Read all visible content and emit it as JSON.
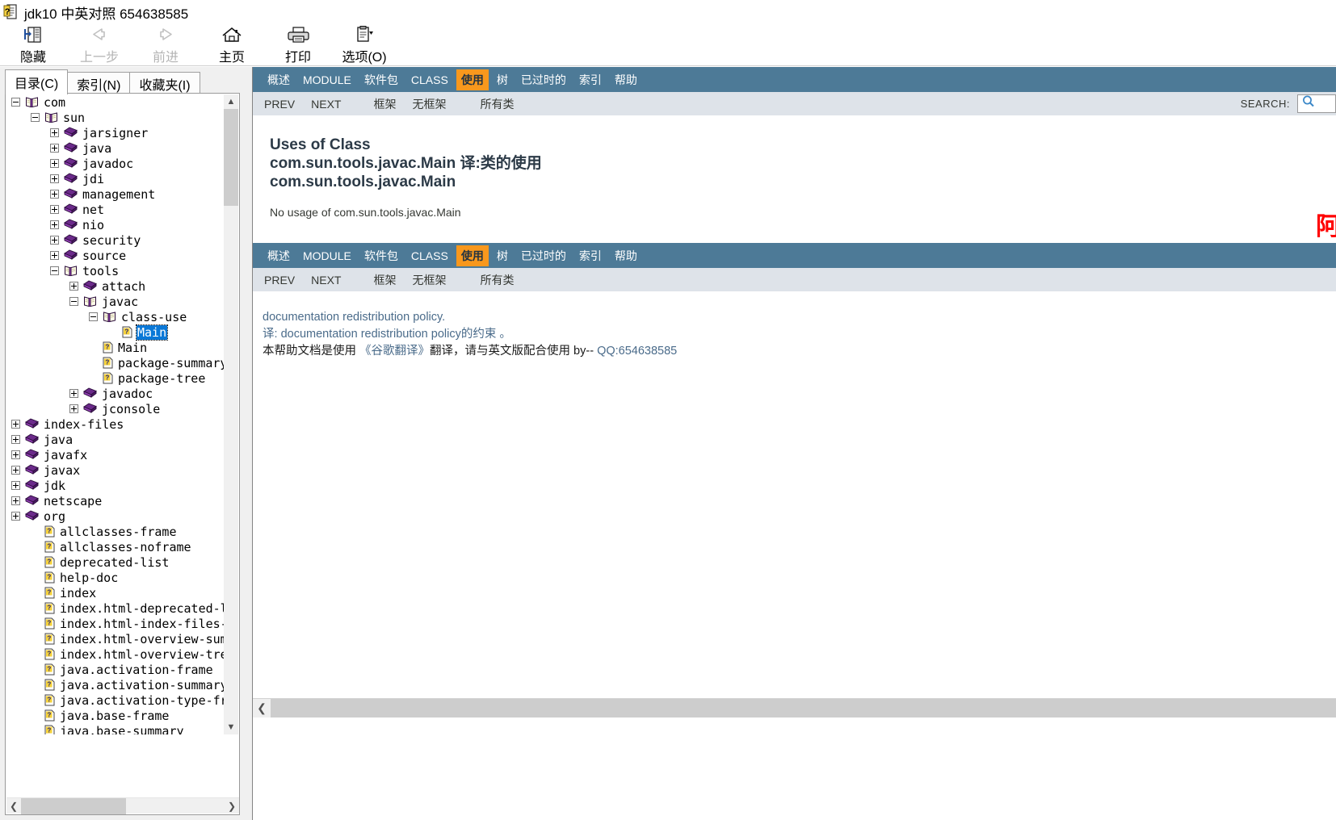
{
  "window": {
    "title": "jdk10 中英对照 654638585",
    "icon": "help-book-icon"
  },
  "toolbar": {
    "buttons": [
      {
        "label": "隐藏",
        "icon": "hide-pane-icon",
        "disabled": false
      },
      {
        "label": "上一步",
        "icon": "back-arrow-icon",
        "disabled": true
      },
      {
        "label": "前进",
        "icon": "forward-arrow-icon",
        "disabled": true
      },
      {
        "label": "主页",
        "icon": "home-icon",
        "disabled": false
      },
      {
        "label": "打印",
        "icon": "printer-icon",
        "disabled": false
      },
      {
        "label": "选项(O)",
        "icon": "options-icon",
        "disabled": false
      }
    ]
  },
  "sidebar": {
    "tabs": [
      {
        "label": "目录(C)",
        "active": true
      },
      {
        "label": "索引(N)",
        "active": false
      },
      {
        "label": "收藏夹(I)",
        "active": false
      }
    ],
    "tree": [
      {
        "label": "com",
        "indent": 0,
        "toggle": "minus",
        "icon": "open-book-icon",
        "selected": false
      },
      {
        "label": "sun",
        "indent": 1,
        "toggle": "minus",
        "icon": "open-book-icon",
        "selected": false
      },
      {
        "label": "jarsigner",
        "indent": 2,
        "toggle": "plus",
        "icon": "closed-book-icon",
        "selected": false
      },
      {
        "label": "java",
        "indent": 2,
        "toggle": "plus",
        "icon": "closed-book-icon",
        "selected": false
      },
      {
        "label": "javadoc",
        "indent": 2,
        "toggle": "plus",
        "icon": "closed-book-icon",
        "selected": false
      },
      {
        "label": "jdi",
        "indent": 2,
        "toggle": "plus",
        "icon": "closed-book-icon",
        "selected": false
      },
      {
        "label": "management",
        "indent": 2,
        "toggle": "plus",
        "icon": "closed-book-icon",
        "selected": false
      },
      {
        "label": "net",
        "indent": 2,
        "toggle": "plus",
        "icon": "closed-book-icon",
        "selected": false
      },
      {
        "label": "nio",
        "indent": 2,
        "toggle": "plus",
        "icon": "closed-book-icon",
        "selected": false
      },
      {
        "label": "security",
        "indent": 2,
        "toggle": "plus",
        "icon": "closed-book-icon",
        "selected": false
      },
      {
        "label": "source",
        "indent": 2,
        "toggle": "plus",
        "icon": "closed-book-icon",
        "selected": false
      },
      {
        "label": "tools",
        "indent": 2,
        "toggle": "minus",
        "icon": "open-book-icon",
        "selected": false
      },
      {
        "label": "attach",
        "indent": 3,
        "toggle": "plus",
        "icon": "closed-book-icon",
        "selected": false
      },
      {
        "label": "javac",
        "indent": 3,
        "toggle": "minus",
        "icon": "open-book-icon",
        "selected": false
      },
      {
        "label": "class-use",
        "indent": 4,
        "toggle": "minus",
        "icon": "open-book-icon",
        "selected": false
      },
      {
        "label": "Main",
        "indent": 5,
        "toggle": "none",
        "icon": "page-icon",
        "selected": true
      },
      {
        "label": "Main",
        "indent": 4,
        "toggle": "none",
        "icon": "page-icon",
        "selected": false
      },
      {
        "label": "package-summary",
        "indent": 4,
        "toggle": "none",
        "icon": "page-icon",
        "selected": false
      },
      {
        "label": "package-tree",
        "indent": 4,
        "toggle": "none",
        "icon": "page-icon",
        "selected": false
      },
      {
        "label": "javadoc",
        "indent": 3,
        "toggle": "plus",
        "icon": "closed-book-icon",
        "selected": false
      },
      {
        "label": "jconsole",
        "indent": 3,
        "toggle": "plus",
        "icon": "closed-book-icon",
        "selected": false
      },
      {
        "label": "index-files",
        "indent": 0,
        "toggle": "plus",
        "icon": "closed-book-icon",
        "selected": false
      },
      {
        "label": "java",
        "indent": 0,
        "toggle": "plus",
        "icon": "closed-book-icon",
        "selected": false
      },
      {
        "label": "javafx",
        "indent": 0,
        "toggle": "plus",
        "icon": "closed-book-icon",
        "selected": false
      },
      {
        "label": "javax",
        "indent": 0,
        "toggle": "plus",
        "icon": "closed-book-icon",
        "selected": false
      },
      {
        "label": "jdk",
        "indent": 0,
        "toggle": "plus",
        "icon": "closed-book-icon",
        "selected": false
      },
      {
        "label": "netscape",
        "indent": 0,
        "toggle": "plus",
        "icon": "closed-book-icon",
        "selected": false
      },
      {
        "label": "org",
        "indent": 0,
        "toggle": "plus",
        "icon": "closed-book-icon",
        "selected": false
      },
      {
        "label": "allclasses-frame",
        "indent": 1,
        "toggle": "none",
        "icon": "page-icon",
        "selected": false
      },
      {
        "label": "allclasses-noframe",
        "indent": 1,
        "toggle": "none",
        "icon": "page-icon",
        "selected": false
      },
      {
        "label": "deprecated-list",
        "indent": 1,
        "toggle": "none",
        "icon": "page-icon",
        "selected": false
      },
      {
        "label": "help-doc",
        "indent": 1,
        "toggle": "none",
        "icon": "page-icon",
        "selected": false
      },
      {
        "label": "index",
        "indent": 1,
        "toggle": "none",
        "icon": "page-icon",
        "selected": false
      },
      {
        "label": "index.html-deprecated-list",
        "indent": 1,
        "toggle": "none",
        "icon": "page-icon",
        "selected": false
      },
      {
        "label": "index.html-index-files-index",
        "indent": 1,
        "toggle": "none",
        "icon": "page-icon",
        "selected": false
      },
      {
        "label": "index.html-overview-summary",
        "indent": 1,
        "toggle": "none",
        "icon": "page-icon",
        "selected": false
      },
      {
        "label": "index.html-overview-tree",
        "indent": 1,
        "toggle": "none",
        "icon": "page-icon",
        "selected": false
      },
      {
        "label": "java.activation-frame",
        "indent": 1,
        "toggle": "none",
        "icon": "page-icon",
        "selected": false
      },
      {
        "label": "java.activation-summary",
        "indent": 1,
        "toggle": "none",
        "icon": "page-icon",
        "selected": false
      },
      {
        "label": "java.activation-type-frame",
        "indent": 1,
        "toggle": "none",
        "icon": "page-icon",
        "selected": false
      },
      {
        "label": "java.base-frame",
        "indent": 1,
        "toggle": "none",
        "icon": "page-icon",
        "selected": false
      },
      {
        "label": "java.base-summary",
        "indent": 1,
        "toggle": "none",
        "icon": "page-icon",
        "selected": false
      }
    ]
  },
  "doc": {
    "navbar_top": [
      {
        "label": "概述",
        "active": false
      },
      {
        "label": "MODULE",
        "active": false
      },
      {
        "label": "软件包",
        "active": false
      },
      {
        "label": "CLASS",
        "active": false
      },
      {
        "label": "使用",
        "active": true
      },
      {
        "label": "树",
        "active": false
      },
      {
        "label": "已过时的",
        "active": false
      },
      {
        "label": "索引",
        "active": false
      },
      {
        "label": "帮助",
        "active": false
      }
    ],
    "subbar_top": {
      "prev": "PREV",
      "next": "NEXT",
      "frames": "框架",
      "noframes": "无框架",
      "allclasses": "所有类",
      "search_label": "SEARCH:",
      "search_value": "",
      "search_icon": "magnifier-icon"
    },
    "navbar_bottom": [
      {
        "label": "概述",
        "active": false
      },
      {
        "label": "MODULE",
        "active": false
      },
      {
        "label": "软件包",
        "active": false
      },
      {
        "label": "CLASS",
        "active": false
      },
      {
        "label": "使用",
        "active": true
      },
      {
        "label": "树",
        "active": false
      },
      {
        "label": "已过时的",
        "active": false
      },
      {
        "label": "索引",
        "active": false
      },
      {
        "label": "帮助",
        "active": false
      }
    ],
    "subbar_bottom": {
      "prev": "PREV",
      "next": "NEXT",
      "frames": "框架",
      "noframes": "无框架",
      "allclasses": "所有类"
    },
    "title_line1": "Uses of Class",
    "title_line2": "com.sun.tools.javac.Main 译:类的使用",
    "title_line3": "com.sun.tools.javac.Main",
    "no_usage": "No usage of com.sun.tools.javac.Main",
    "red_mark": "阿",
    "footer": {
      "line1": "documentation redistribution policy.",
      "line2_prefix": "译: ",
      "line2_link": "documentation redistribution policy",
      "line2_suffix": "的约束 。",
      "line3_a": "本帮助文档是使用 ",
      "line3_b": "《谷歌翻译》",
      "line3_c": "翻译，请与英文版配合使用 by-- ",
      "line3_d": "QQ:654638585"
    }
  },
  "colors": {
    "navbar_blue": "#4d7a97",
    "active_orange": "#f8981d",
    "subbar_gray": "#dee3e9",
    "selection_blue": "#0a78d7",
    "link_blue": "#4a6b8a",
    "red": "#ff0000"
  }
}
